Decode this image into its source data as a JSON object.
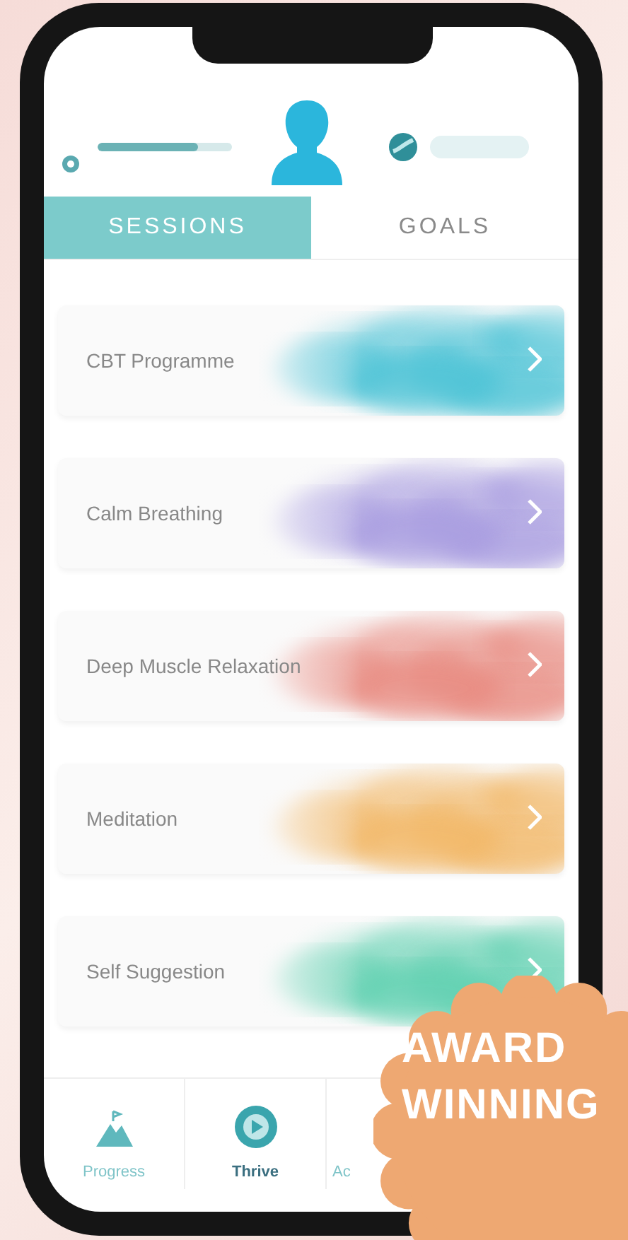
{
  "header": {
    "level": 0.75
  },
  "tabs": [
    {
      "label": "SESSIONS",
      "selected": true
    },
    {
      "label": "GOALS",
      "selected": false
    }
  ],
  "sessions": [
    {
      "title": "CBT Programme",
      "color": "#4cc3d6"
    },
    {
      "title": "Calm Breathing",
      "color": "#a79be0"
    },
    {
      "title": "Deep Muscle Relaxation",
      "color": "#e88a80"
    },
    {
      "title": "Meditation",
      "color": "#f2b766"
    },
    {
      "title": "Self Suggestion",
      "color": "#5fd0b0"
    }
  ],
  "nav": [
    {
      "label": "Progress",
      "selected": false,
      "kind": "progress"
    },
    {
      "label": "Thrive",
      "selected": true,
      "kind": "thrive"
    },
    {
      "label": "Ac",
      "selected": false,
      "kind": "other"
    }
  ],
  "badge": {
    "lines": [
      "AWARD",
      "WINNING"
    ]
  }
}
